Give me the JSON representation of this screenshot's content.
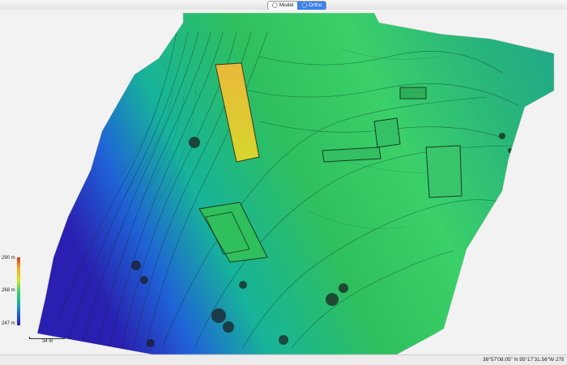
{
  "toolbar": {
    "model_label": "Model",
    "model_icon": "globe-icon",
    "ortho_label": "Ortho",
    "ortho_icon": "globe-icon",
    "active_mode": "Ortho",
    "accent": "#3b82e8"
  },
  "legend": {
    "max_label": "290 m",
    "mid_label": "268 m",
    "min_label": "247 m",
    "colors": [
      "#e0311b",
      "#f0b022",
      "#d8e22a",
      "#3bd06a",
      "#17b39a",
      "#1f63d6",
      "#2a1fb0"
    ]
  },
  "scale": {
    "label": "34 m"
  },
  "status": {
    "coordinates": "38°57'08.05\" N  95°17'31.56\"W 278"
  }
}
